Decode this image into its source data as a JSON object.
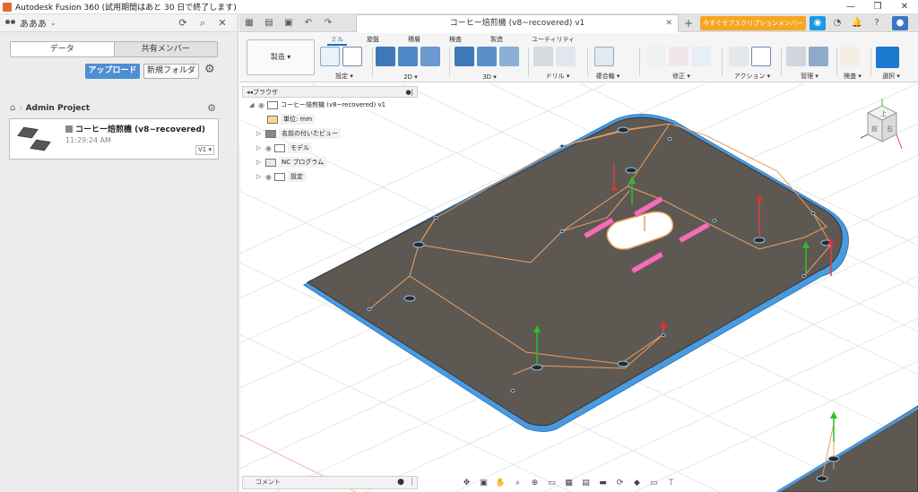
{
  "window": {
    "title": "Autodesk Fusion 360 (試用期間はあと 30 日で終了します)",
    "minimize": "—",
    "maximize": "❐",
    "close": "✕"
  },
  "data_panel": {
    "team_name": "あああ",
    "tabs": [
      "データ",
      "共有メンバー"
    ],
    "upload_label": "アップロード",
    "new_folder_label": "新規フォルダ",
    "breadcrumb_project": "Admin Project",
    "file": {
      "name": "コーヒー焙煎機 (v8~recovered)",
      "time": "11:29:24 AM",
      "version": "V1 ▾"
    }
  },
  "tabbar": {
    "document_title": "コーヒー焙煎機 (v8~recovered) v1",
    "promo_label": "今すぐサブスクリプションメンバーに..."
  },
  "ribbon": {
    "workspace_label": "製造 ▾",
    "tabs": [
      "ミル",
      "旋盤",
      "積層",
      "検査",
      "製造",
      "ユーティリティ"
    ],
    "groups": [
      {
        "label": "設定 ▾"
      },
      {
        "label": "2D ▾"
      },
      {
        "label": "3D ▾"
      },
      {
        "label": "ドリル ▾"
      },
      {
        "label": "複合軸 ▾"
      },
      {
        "label": "修正 ▾"
      },
      {
        "label": "アクション ▾"
      },
      {
        "label": "管理 ▾"
      },
      {
        "label": "検査 ▾"
      },
      {
        "label": "選択 ▾"
      }
    ]
  },
  "browser": {
    "title": "ブラウザ",
    "rows": [
      {
        "label": "コーヒー焙煎機 (v8~recovered) v1"
      },
      {
        "label": "単位: mm"
      },
      {
        "label": "名前の付いたビュー"
      },
      {
        "label": "モデル"
      },
      {
        "label": "NC プログラム"
      },
      {
        "label": "設定"
      }
    ]
  },
  "viewcube": {
    "top_label": "上",
    "front_label": "前",
    "right_label": "右"
  },
  "comment_bar": {
    "label": "コメント"
  },
  "colors": {
    "accent": "#1a6fc2",
    "upload": "#4e8ed3",
    "promo": "#f6a623",
    "plate_fill": "#5e5852",
    "plate_edge": "#4a9ae0",
    "toolpath": "#e8a060",
    "tab_pink": "#f070b8"
  }
}
